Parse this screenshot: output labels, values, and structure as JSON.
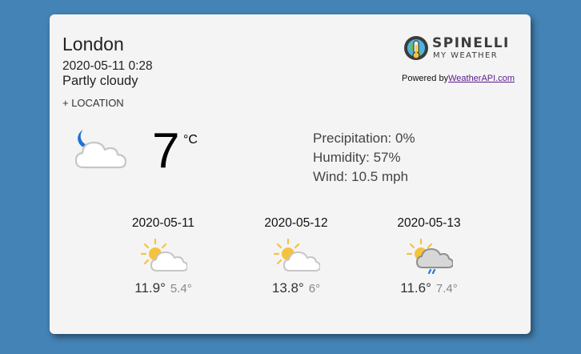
{
  "location": {
    "city": "London",
    "datetime": "2020-05-11 0:28",
    "condition": "Partly cloudy",
    "add_location_label": "+ LOCATION"
  },
  "brand": {
    "name": "SPINELLI",
    "tagline": "MY WEATHER",
    "powered_prefix": "Powered by",
    "powered_link": "WeatherAPI.com"
  },
  "current": {
    "icon": "moon-cloud-icon",
    "temperature": "7",
    "unit": "°C",
    "precipitation": "Precipitation: 0%",
    "humidity": "Humidity: 57%",
    "wind": "Wind: 10.5 mph"
  },
  "forecast": [
    {
      "date": "2020-05-11",
      "icon": "sun-cloud-icon",
      "high": "11.9°",
      "low": "5.4°"
    },
    {
      "date": "2020-05-12",
      "icon": "sun-cloud-icon",
      "high": "13.8°",
      "low": "6°"
    },
    {
      "date": "2020-05-13",
      "icon": "sun-rain-cloud-icon",
      "high": "11.6°",
      "low": "7.4°"
    }
  ],
  "colors": {
    "background": "#4483b6",
    "card": "#f4f4f4",
    "moon": "#1f6fd6",
    "sun": "#f5c33b",
    "rain": "#2f7fd8"
  }
}
